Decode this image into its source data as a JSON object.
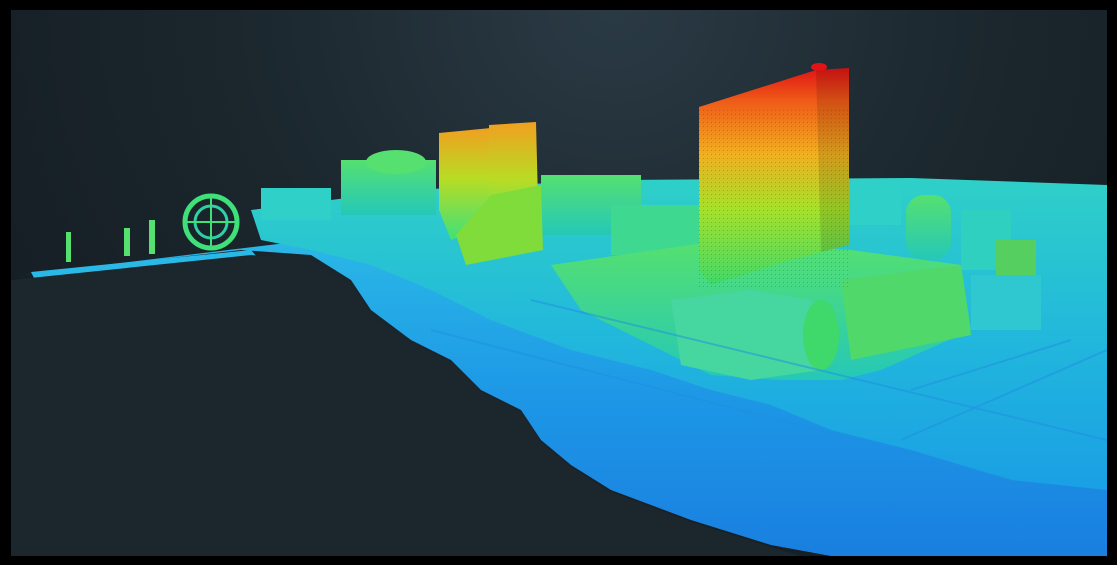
{
  "scene": {
    "colormap": [
      "#1f6fe0",
      "#1ea3ec",
      "#25d3d3",
      "#3fe07a",
      "#a6e02a",
      "#f0c020",
      "#ef6a1a",
      "#e01818"
    ],
    "background": "#1b262d",
    "frame": "#000000"
  }
}
